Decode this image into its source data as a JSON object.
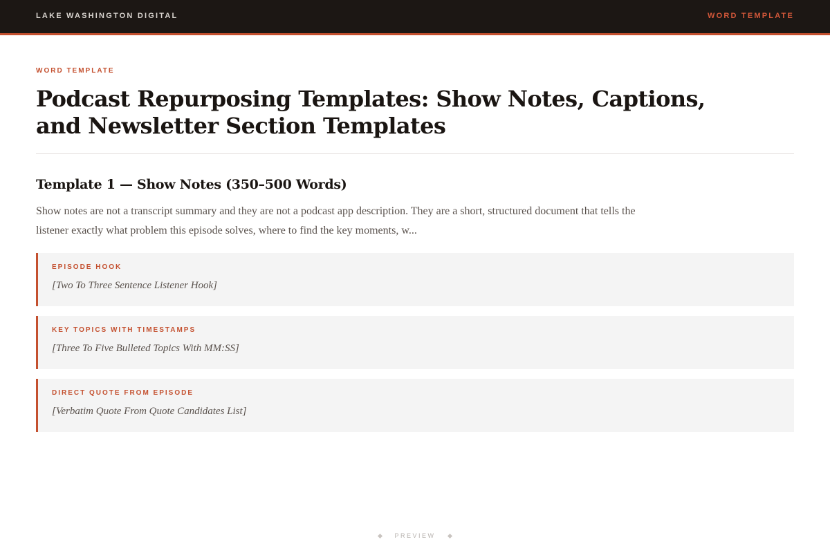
{
  "header": {
    "brand": "LAKE WASHINGTON DIGITAL",
    "tag": "WORD TEMPLATE"
  },
  "doc": {
    "eyebrow": "WORD TEMPLATE",
    "title": "Podcast Repurposing Templates: Show Notes, Captions, and Newsletter Section Templates",
    "section_title": "Template 1 — Show Notes (350–500 Words)",
    "intro": "Show notes are not a transcript summary and they are not a podcast app description. They are a short, structured document that tells the listener exactly what problem this episode solves, where to find the key moments, w..."
  },
  "blocks": [
    {
      "label": "EPISODE HOOK",
      "body": "[Two To Three Sentence Listener Hook]"
    },
    {
      "label": "KEY TOPICS WITH TIMESTAMPS",
      "body": "[Three To Five Bulleted Topics With MM:SS]"
    },
    {
      "label": "DIRECT QUOTE FROM EPISODE",
      "body": "[Verbatim Quote From Quote Candidates List]"
    }
  ],
  "footer": {
    "label": "PREVIEW"
  },
  "colors": {
    "accent": "#c4502f",
    "topbar": "#1c1714",
    "block_bg": "#f4f4f4"
  }
}
